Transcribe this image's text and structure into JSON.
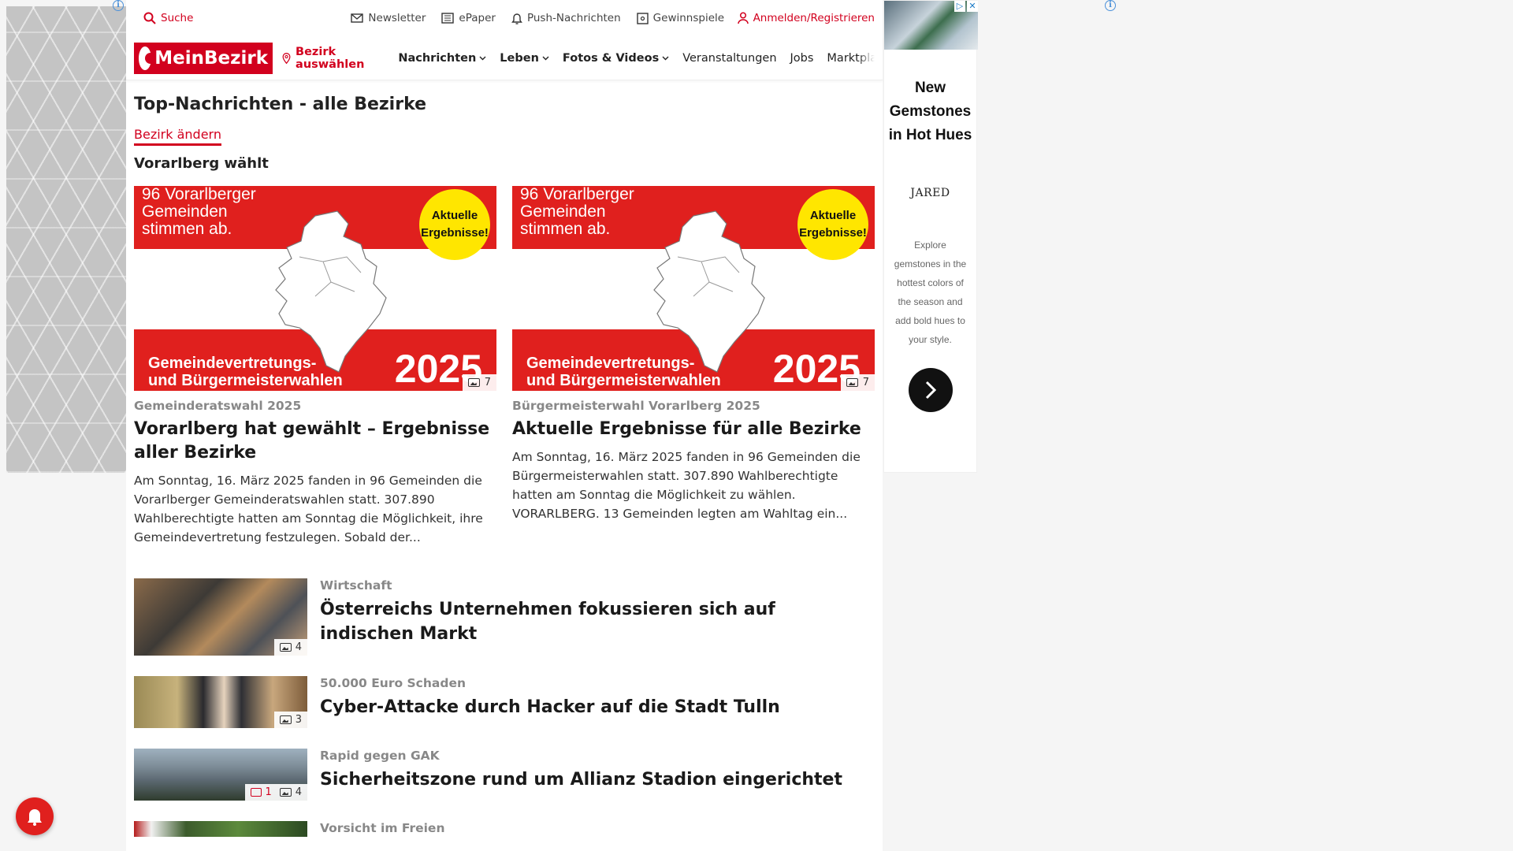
{
  "header": {
    "search_label": "Suche",
    "utility": {
      "newsletter": "Newsletter",
      "epaper": "ePaper",
      "push": "Push-Nachrichten",
      "gewinnspiele": "Gewinnspiele"
    },
    "login_label": "Anmelden/Registrieren"
  },
  "nav": {
    "logo": "MeinBezirk",
    "bezirk_select": "Bezirk auswählen",
    "items": [
      "Nachrichten",
      "Leben",
      "Fotos & Videos",
      "Veranstaltungen",
      "Jobs",
      "Marktplatz"
    ]
  },
  "page": {
    "title": "Top-Nachrichten - alle Bezirke",
    "change_link": "Bezirk ändern",
    "section_title": "Vorarlberg wählt"
  },
  "promo_image": {
    "top_line1": "96 Vorarlberger",
    "top_line2": "Gemeinden",
    "top_line3": "stimmen ab.",
    "badge_line1": "Aktuelle",
    "badge_line2": "Ergebnisse!",
    "bottom_line1": "Gemeindevertretungs-",
    "bottom_line2": "und Bürgermeisterwahlen",
    "year": "2025"
  },
  "top_cards": [
    {
      "image_count": "7",
      "kicker": "Gemeinderatswahl 2025",
      "title": "Vorarlberg hat gewählt – Ergebnisse aller Bezirke",
      "text": "Am Sonntag, 16. März 2025 fanden in 96 Gemeinden die Vorarlberger Gemeinderatswahlen statt. 307.890 Wahlberechtigte hatten am Sonntag die Möglichkeit, ihre Gemeindevertretung festzulegen. Sobald der..."
    },
    {
      "image_count": "7",
      "kicker": "Bürgermeisterwahl Vorarlberg 2025",
      "title": "Aktuelle Ergebnisse für alle Bezirke",
      "text": "Am Sonntag, 16. März 2025 fanden in 96 Gemeinden die Bürgermeisterwahlen statt. 307.890 Wahlberechtigte hatten am Sonntag die Möglichkeit zu wählen. VORARLBERG. 13 Gemeinden legten am Wahltag ein..."
    }
  ],
  "articles": [
    {
      "kicker": "Wirtschaft",
      "title": "Österreichs Unternehmen fokussieren sich auf indischen Markt",
      "image_count": "4",
      "comment_count": ""
    },
    {
      "kicker": "50.000 Euro Schaden",
      "title": "Cyber-Attacke durch Hacker auf die Stadt Tulln",
      "image_count": "3",
      "comment_count": ""
    },
    {
      "kicker": "Rapid gegen GAK",
      "title": "Sicherheitszone rund um Allianz Stadion eingerichtet",
      "image_count": "4",
      "comment_count": "1"
    },
    {
      "kicker": "Vorsicht im Freien",
      "title": "",
      "image_count": "",
      "comment_count": ""
    }
  ],
  "ad": {
    "headline_line1": "New",
    "headline_line2": "Gemstones",
    "headline_line3": "in Hot Hues",
    "brand": "JARED",
    "text": "Explore gemstones in the hottest colors of the season and add bold hues to your style.",
    "ad_choices": "▷",
    "close": "✕",
    "info": "i"
  },
  "colors": {
    "brand_red": "#d2001e",
    "badge_yellow": "#ffe600"
  },
  "icons": [
    "search-icon",
    "mail-icon",
    "newspaper-icon",
    "bell-icon",
    "ticket-icon",
    "user-icon",
    "location-pin-icon",
    "chevron-down-icon",
    "image-icon",
    "comment-icon",
    "arrow-right-icon"
  ]
}
